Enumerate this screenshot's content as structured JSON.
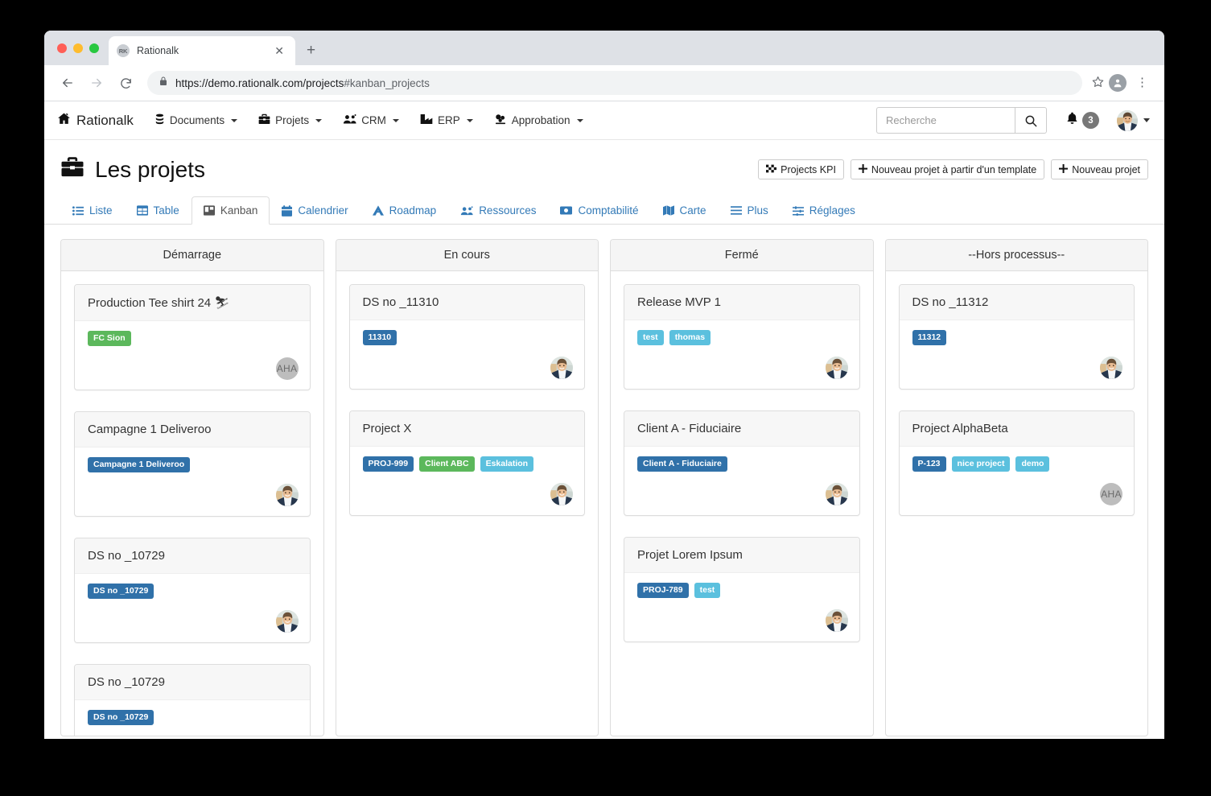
{
  "browser": {
    "tab_title": "Rationalk",
    "favicon_text": "RK",
    "close_label": "✕",
    "newtab_label": "+",
    "url_secure": "https://demo.rationalk.com/projects",
    "url_hash": "#kanban_projects"
  },
  "navbar": {
    "brand": "Rationalk",
    "items": [
      {
        "label": "Documents",
        "icon": "database-icon"
      },
      {
        "label": "Projets",
        "icon": "briefcase-icon"
      },
      {
        "label": "CRM",
        "icon": "users-icon"
      },
      {
        "label": "ERP",
        "icon": "factory-icon"
      },
      {
        "label": "Approbation",
        "icon": "stamp-icon"
      }
    ],
    "search_placeholder": "Recherche",
    "search_value": "",
    "notification_count": "3"
  },
  "page": {
    "title": "Les projets",
    "actions": [
      {
        "label": "Projects KPI",
        "icon": "flag-icon"
      },
      {
        "label": "Nouveau projet à partir d'un template",
        "icon": "plus-icon"
      },
      {
        "label": "Nouveau projet",
        "icon": "plus-icon"
      }
    ]
  },
  "tabs": [
    {
      "label": "Liste",
      "icon": "list-icon",
      "active": false
    },
    {
      "label": "Table",
      "icon": "table-icon",
      "active": false
    },
    {
      "label": "Kanban",
      "icon": "kanban-icon",
      "active": true
    },
    {
      "label": "Calendrier",
      "icon": "calendar-icon",
      "active": false
    },
    {
      "label": "Roadmap",
      "icon": "roadmap-icon",
      "active": false
    },
    {
      "label": "Ressources",
      "icon": "users-icon",
      "active": false
    },
    {
      "label": "Comptabilité",
      "icon": "money-icon",
      "active": false
    },
    {
      "label": "Carte",
      "icon": "map-icon",
      "active": false
    },
    {
      "label": "Plus",
      "icon": "bars-icon",
      "active": false
    },
    {
      "label": "Réglages",
      "icon": "sliders-icon",
      "active": false
    }
  ],
  "colors": {
    "label_blue": "#3071a9",
    "label_green": "#5cb85c",
    "label_cyan": "#5bc0de",
    "tab_link": "#337ab7",
    "badge_grey": "#777777",
    "avatar_grey": "#bdbdbd"
  },
  "board": {
    "columns": [
      {
        "title": "Démarrage",
        "cards": [
          {
            "title": "Production Tee shirt 24 ⛷",
            "labels": [
              {
                "text": "FC Sion",
                "color": "#5cb85c"
              }
            ],
            "avatar": "initials",
            "initials": "AHA"
          },
          {
            "title": "Campagne 1 Deliveroo",
            "labels": [
              {
                "text": "Campagne 1 Deliveroo",
                "color": "#3071a9"
              }
            ],
            "avatar": "photo",
            "initials": ""
          },
          {
            "title": "DS no _10729",
            "labels": [
              {
                "text": "DS no _10729",
                "color": "#3071a9"
              }
            ],
            "avatar": "photo",
            "initials": ""
          },
          {
            "title": "DS no _10729",
            "labels": [
              {
                "text": "DS no _10729",
                "color": "#3071a9"
              }
            ],
            "avatar": "photo",
            "initials": ""
          }
        ]
      },
      {
        "title": "En cours",
        "cards": [
          {
            "title": "DS no _11310",
            "labels": [
              {
                "text": "11310",
                "color": "#3071a9"
              }
            ],
            "avatar": "photo",
            "initials": ""
          },
          {
            "title": "Project X",
            "labels": [
              {
                "text": "PROJ-999",
                "color": "#3071a9"
              },
              {
                "text": "Client ABC",
                "color": "#5cb85c"
              },
              {
                "text": "Eskalation",
                "color": "#5bc0de"
              }
            ],
            "avatar": "photo",
            "initials": ""
          }
        ]
      },
      {
        "title": "Fermé",
        "cards": [
          {
            "title": "Release MVP 1",
            "labels": [
              {
                "text": "test",
                "color": "#5bc0de"
              },
              {
                "text": "thomas",
                "color": "#5bc0de"
              }
            ],
            "avatar": "photo",
            "initials": ""
          },
          {
            "title": "Client A - Fiduciaire",
            "labels": [
              {
                "text": "Client A - Fiduciaire",
                "color": "#3071a9"
              }
            ],
            "avatar": "photo",
            "initials": ""
          },
          {
            "title": "Projet Lorem Ipsum",
            "labels": [
              {
                "text": "PROJ-789",
                "color": "#3071a9"
              },
              {
                "text": "test",
                "color": "#5bc0de"
              }
            ],
            "avatar": "photo",
            "initials": ""
          }
        ]
      },
      {
        "title": "--Hors processus--",
        "cards": [
          {
            "title": "DS no _11312",
            "labels": [
              {
                "text": "11312",
                "color": "#3071a9"
              }
            ],
            "avatar": "photo",
            "initials": ""
          },
          {
            "title": "Project AlphaBeta",
            "labels": [
              {
                "text": "P-123",
                "color": "#3071a9"
              },
              {
                "text": "nice project",
                "color": "#5bc0de"
              },
              {
                "text": "demo",
                "color": "#5bc0de"
              }
            ],
            "avatar": "initials",
            "initials": "AHA"
          }
        ]
      }
    ]
  }
}
